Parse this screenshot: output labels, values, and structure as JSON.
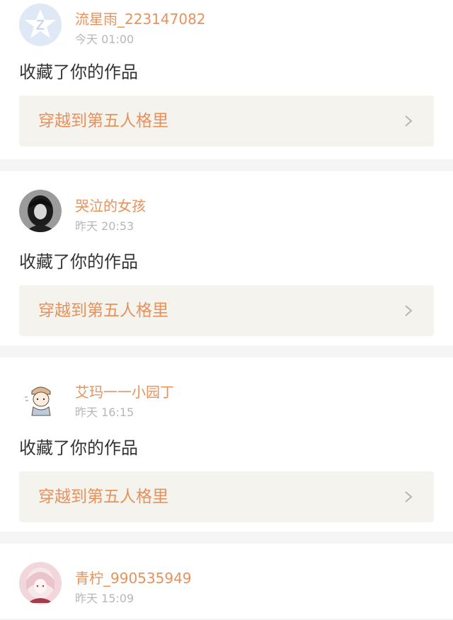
{
  "notifications": [
    {
      "username": "流星雨_223147082",
      "time": "今天 01:00",
      "action": "收藏了你的作品",
      "work_title": "穿越到第五人格里",
      "avatar": "default-star-avatar"
    },
    {
      "username": "哭泣的女孩",
      "time": "昨天 20:53",
      "action": "收藏了你的作品",
      "work_title": "穿越到第五人格里",
      "avatar": "dark-hair-girl-avatar"
    },
    {
      "username": "艾玛一一小园丁",
      "time": "昨天 16:15",
      "action": "收藏了你的作品",
      "work_title": "穿越到第五人格里",
      "avatar": "gardener-sketch-avatar"
    },
    {
      "username": "青柠_990535949",
      "time": "昨天 15:09",
      "avatar": "anime-girl-avatar"
    }
  ],
  "colors": {
    "accent": "#e8915a",
    "link_bg": "#f4f3ee",
    "time": "#b7b7b7",
    "separator": "#f5f5f5"
  }
}
